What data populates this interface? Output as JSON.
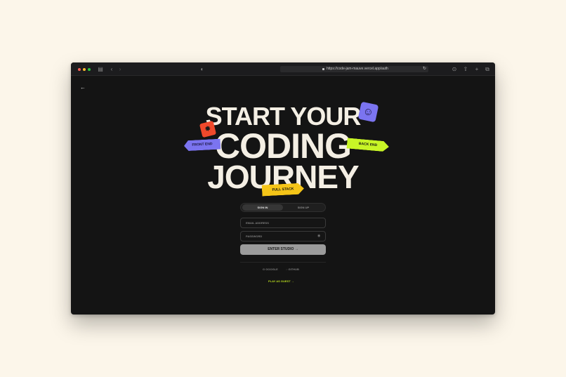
{
  "browser": {
    "url": "https://code-jam-mauve.vercel.app/auth",
    "traffic_lights": [
      "#ff5f57",
      "#febc2e",
      "#28c840"
    ],
    "icons": [
      "sidebar-icon",
      "chevron-left-icon",
      "chevron-right-icon",
      "shield-icon",
      "reload-icon",
      "download-icon",
      "share-icon",
      "new-tab-icon",
      "tab-overview-icon"
    ]
  },
  "page": {
    "back_icon": "arrow-left-icon",
    "headline": {
      "line1": "START YOUR",
      "line2": "CODING",
      "line3": "JOURNEY"
    },
    "tags": {
      "front_end": "FRONT END",
      "back_end": "BACK END",
      "full_stack": "FULL STACK"
    },
    "auth_tabs": {
      "sign_in": "SIGN IN",
      "sign_up": "SIGN UP"
    },
    "form": {
      "email_placeholder": "EMAIL ADDRESS",
      "password_placeholder": "PASSWORD",
      "submit_label": "ENTER STUDIO →"
    },
    "social": {
      "google": "GOOGLE",
      "github": "GITHUB"
    },
    "guest_link": "PLAY AS GUEST →"
  },
  "colors": {
    "background": "#fcf6ea",
    "app_bg": "#141414",
    "accent_purple": "#7b74f0",
    "accent_lime": "#c8f526",
    "accent_yellow": "#f5c518",
    "accent_red": "#f0492b"
  }
}
